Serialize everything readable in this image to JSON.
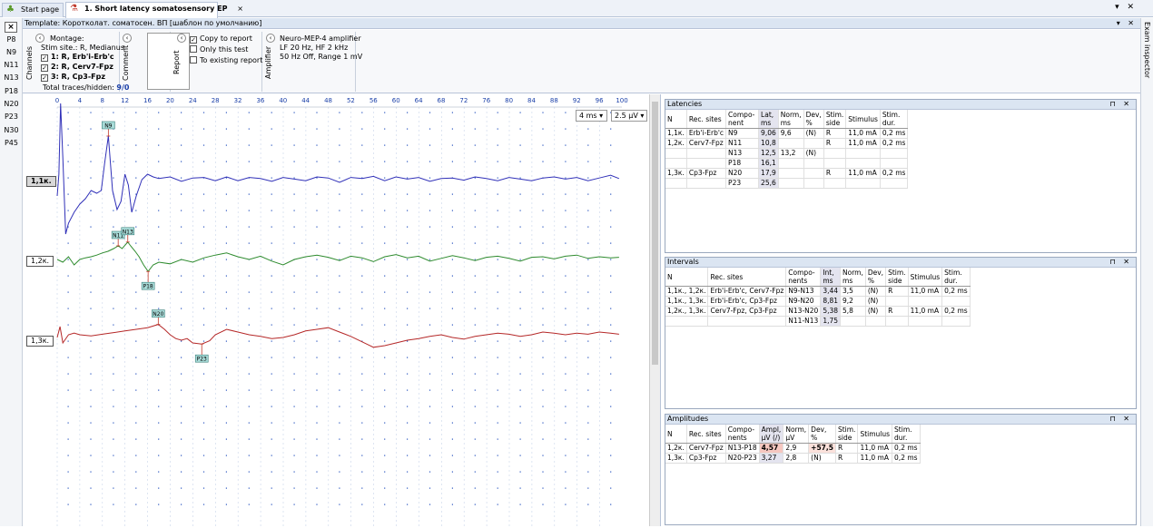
{
  "tabs": [
    {
      "label": "Start page"
    },
    {
      "label": "1. Short latency somatosensory EP"
    }
  ],
  "left_components": [
    "P8",
    "N9",
    "N11",
    "N13",
    "P18",
    "N20",
    "P23",
    "N30",
    "P45"
  ],
  "right_strip": {
    "label": "Exam inspector"
  },
  "template": {
    "label": "Template: Коротколат. соматосен. ВП [шаблон по умолчанию]"
  },
  "channels": {
    "group_label": "Channels",
    "montage": "Montage:",
    "stim_site": "Stim site.: R, Medianus",
    "items": [
      {
        "label": "1: R, Erb'i-Erb'c"
      },
      {
        "label": "2: R, Cerv7-Fpz"
      },
      {
        "label": "3: R, Cp3-Fpz"
      }
    ],
    "total_label": "Total traces/hidden:",
    "total_value": "9/0"
  },
  "comment": {
    "group_label": "Comment"
  },
  "report": {
    "group_label": "Report",
    "copy": "Copy to report",
    "only": "Only this test",
    "existing": "To existing report"
  },
  "amplifier": {
    "group_label": "Amplifier",
    "name": "Neuro-MEP-4 amplifier",
    "line1": "LF  20 Hz, HF  2 kHz",
    "line2": "50 Hz  Off, Range 1 mV"
  },
  "chart_controls": {
    "timebase": "4 ms",
    "sensitivity": "2.5 µV"
  },
  "chart_data": {
    "type": "line",
    "x_ticks": [
      0,
      4,
      8,
      12,
      16,
      20,
      24,
      28,
      32,
      36,
      40,
      44,
      48,
      52,
      56,
      60,
      64,
      68,
      72,
      76,
      80,
      84,
      88,
      92,
      96,
      100
    ],
    "xlim": [
      0,
      100
    ],
    "series": [
      {
        "name": "1,1к.",
        "color": "#3030b8",
        "x": [
          0,
          0.3,
          0.6,
          1,
          1.5,
          2,
          3,
          4,
          5,
          6,
          7,
          7.8,
          8.4,
          9.06,
          9.8,
          10.6,
          11.3,
          12,
          12.6,
          13.2,
          14,
          15,
          16,
          17,
          18,
          20,
          22,
          24,
          26,
          28,
          30,
          32,
          34,
          36,
          38,
          40,
          42,
          44,
          46,
          48,
          50,
          52,
          54,
          56,
          58,
          60,
          62,
          64,
          66,
          68,
          70,
          72,
          74,
          76,
          78,
          80,
          82,
          84,
          86,
          88,
          90,
          92,
          94,
          96,
          98,
          99.5
        ],
        "y": [
          -3,
          1,
          14,
          4,
          -10,
          -8,
          -6,
          -4.5,
          -3.5,
          -2,
          -2.5,
          -2,
          3,
          8,
          -2,
          -5.5,
          -4,
          1,
          -1,
          -6,
          -3,
          0,
          1,
          0.5,
          0.2,
          0.5,
          -0.3,
          0.3,
          0.4,
          -0.2,
          0.5,
          -0.2,
          0.4,
          0.2,
          -0.3,
          0.4,
          0.1,
          -0.2,
          0.5,
          0.3,
          -0.5,
          0.4,
          0.2,
          0.6,
          -0.2,
          0.5,
          0.1,
          0.4,
          -0.3,
          0.2,
          0.3,
          -0.1,
          0.5,
          0.2,
          -0.2,
          0.4,
          0.1,
          -0.2,
          0.3,
          0.5,
          0.1,
          0.4,
          -0.2,
          0.3,
          0.8,
          0.2
        ]
      },
      {
        "name": "1,2к.",
        "color": "#2e8b2e",
        "x": [
          0,
          1,
          2,
          3,
          4,
          5,
          6,
          7,
          8,
          9,
          10,
          10.8,
          11.5,
          12.5,
          13,
          13.8,
          14.5,
          15.3,
          16.1,
          17,
          18,
          20,
          22,
          24,
          26,
          28,
          30,
          32,
          34,
          36,
          38,
          40,
          42,
          44,
          46,
          48,
          50,
          52,
          54,
          56,
          58,
          60,
          62,
          64,
          66,
          68,
          70,
          72,
          74,
          76,
          78,
          80,
          82,
          84,
          86,
          88,
          90,
          92,
          94,
          96,
          98,
          99.5
        ],
        "y": [
          0,
          -0.5,
          0.5,
          -1,
          0,
          0.3,
          0.5,
          0.8,
          1.2,
          1.5,
          2,
          2.5,
          2,
          3.2,
          2.5,
          1.5,
          0.5,
          -1,
          -2.2,
          -1,
          -0.5,
          -0.8,
          0,
          -0.5,
          0.3,
          0.8,
          1.2,
          0.5,
          0,
          0.6,
          -0.3,
          -1,
          0,
          0.5,
          0.8,
          0.4,
          -0.2,
          0.6,
          0.3,
          -0.4,
          0.5,
          0.9,
          0.3,
          0.6,
          -0.3,
          0.2,
          0.7,
          0.3,
          -0.2,
          0.4,
          0.6,
          0.2,
          -0.3,
          0.4,
          0.5,
          0.1,
          0.6,
          0.8,
          0.2,
          0.5,
          0.3,
          0.4
        ]
      },
      {
        "name": "1,3к.",
        "color": "#b52828",
        "x": [
          0,
          0.5,
          1,
          2,
          3,
          4,
          6,
          8,
          10,
          12,
          14,
          16,
          17.9,
          19,
          20,
          21,
          22,
          23,
          24,
          25.6,
          27,
          28,
          30,
          32,
          34,
          36,
          38,
          40,
          42,
          44,
          46,
          48,
          50,
          52,
          54,
          56,
          58,
          60,
          62,
          64,
          66,
          68,
          70,
          72,
          74,
          76,
          78,
          80,
          82,
          84,
          86,
          88,
          90,
          92,
          94,
          96,
          98,
          99.5
        ],
        "y": [
          0,
          2,
          -1,
          0.5,
          0.8,
          0.5,
          0.3,
          0.6,
          0.9,
          1.2,
          1.5,
          1.8,
          2.4,
          1.5,
          0.5,
          -0.2,
          -0.5,
          -0.2,
          -1,
          -1.2,
          -0.6,
          0.5,
          1.5,
          1,
          0.5,
          0.2,
          -0.2,
          0,
          0.5,
          1.2,
          1.5,
          1.8,
          1,
          0.2,
          -0.8,
          -1.8,
          -1.5,
          -1,
          -0.5,
          -0.2,
          0.2,
          0.5,
          0,
          -0.3,
          0.2,
          0.5,
          0.8,
          0.6,
          0.2,
          0.5,
          1,
          0.8,
          0.5,
          0.8,
          0.6,
          1,
          0.8,
          0.6
        ]
      }
    ],
    "markers": [
      {
        "label": "N9",
        "series": 0,
        "x": 9.06
      },
      {
        "label": "N11",
        "series": 1,
        "x": 10.8
      },
      {
        "label": "N13",
        "series": 1,
        "x": 12.5
      },
      {
        "label": "P18",
        "series": 1,
        "x": 16.1
      },
      {
        "label": "N20",
        "series": 2,
        "x": 17.9
      },
      {
        "label": "P23",
        "series": 2,
        "x": 25.6
      }
    ]
  },
  "latencies": {
    "title": "Latencies",
    "headers": [
      "N",
      "Rec. sites",
      "Compo-nent",
      "Lat, ms",
      "Norm, ms",
      "Dev, %",
      "Stim. side",
      "Stimulus",
      "Stim. dur."
    ],
    "rows": [
      [
        "1,1к.",
        "Erb'i-Erb'c",
        "N9",
        "9,06",
        "9,6",
        "(N)",
        "R",
        "11,0 mA",
        "0,2 ms"
      ],
      [
        "1,2к.",
        "Cerv7-Fpz",
        "N11",
        "10,8",
        "",
        "",
        "R",
        "11,0 mA",
        "0,2 ms"
      ],
      [
        "",
        "",
        "N13",
        "12,5",
        "13,2",
        "(N)",
        "",
        "",
        ""
      ],
      [
        "",
        "",
        "P18",
        "16,1",
        "",
        "",
        "",
        "",
        ""
      ],
      [
        "1,3к.",
        "Cp3-Fpz",
        "N20",
        "17,9",
        "",
        "",
        "R",
        "11,0 mA",
        "0,2 ms"
      ],
      [
        "",
        "",
        "P23",
        "25,6",
        "",
        "",
        "",
        "",
        ""
      ]
    ]
  },
  "intervals": {
    "title": "Intervals",
    "headers": [
      "N",
      "Rec. sites",
      "Compo-nents",
      "Int, ms",
      "Norm, ms",
      "Dev, %",
      "Stim. side",
      "Stimulus",
      "Stim. dur."
    ],
    "rows": [
      [
        "1,1к., 1,2к.",
        "Erb'i-Erb'c, Cerv7-Fpz",
        "N9-N13",
        "3,44",
        "3,5",
        "(N)",
        "R",
        "11,0 mA",
        "0,2 ms"
      ],
      [
        "1,1к., 1,3к.",
        "Erb'i-Erb'c, Cp3-Fpz",
        "N9-N20",
        "8,81",
        "9,2",
        "(N)",
        "",
        "",
        ""
      ],
      [
        "1,2к., 1,3к.",
        "Cerv7-Fpz, Cp3-Fpz",
        "N13-N20",
        "5,38",
        "5,8",
        "(N)",
        "R",
        "11,0 mA",
        "0,2 ms"
      ],
      [
        "",
        "",
        "N11-N13",
        "1,75",
        "",
        "",
        "",
        "",
        ""
      ]
    ]
  },
  "amplitudes": {
    "title": "Amplitudes",
    "headers": [
      "N",
      "Rec. sites",
      "Compo-nents",
      "Ampl, µV (/)",
      "Norm, µV",
      "Dev, %",
      "Stim. side",
      "Stimulus",
      "Stim. dur."
    ],
    "rows": [
      [
        "1,2к.",
        "Cerv7-Fpz",
        "N13-P18",
        "4,57",
        "2,9",
        "+57,5",
        "R",
        "11,0 mA",
        "0,2 ms"
      ],
      [
        "1,3к.",
        "Cp3-Fpz",
        "N20-P23",
        "3,27",
        "2,8",
        "(N)",
        "R",
        "11,0 mA",
        "0,2 ms"
      ]
    ]
  },
  "colors": {
    "accent": "#dbe5f2",
    "grid_dot": "#2a55c0"
  }
}
